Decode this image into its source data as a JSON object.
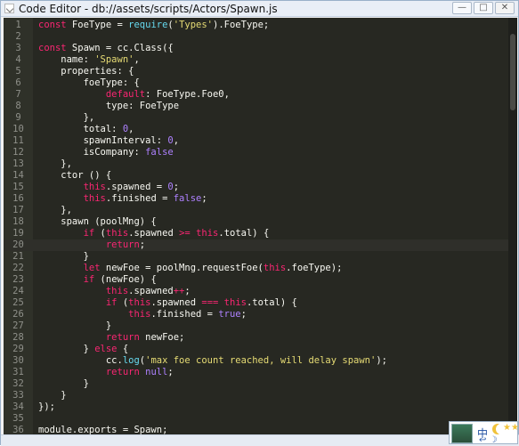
{
  "window": {
    "title": "Code Editor - db://assets/scripts/Actors/Spawn.js",
    "buttons": [
      "—",
      "□",
      "✕"
    ]
  },
  "editor": {
    "active_line": 20,
    "lines": [
      [
        [
          "k",
          "const"
        ],
        [
          "t",
          " FoeType = "
        ],
        [
          "f",
          "require"
        ],
        [
          "t",
          "("
        ],
        [
          "s",
          "'Types'"
        ],
        [
          "t",
          ").FoeType;"
        ]
      ],
      [],
      [
        [
          "k",
          "const"
        ],
        [
          "t",
          " Spawn = cc.Class({"
        ]
      ],
      [
        [
          "t",
          "    name: "
        ],
        [
          "s",
          "'Spawn'"
        ],
        [
          "t",
          ","
        ]
      ],
      [
        [
          "t",
          "    properties: {"
        ]
      ],
      [
        [
          "t",
          "        foeType: {"
        ]
      ],
      [
        [
          "t",
          "            "
        ],
        [
          "k",
          "default"
        ],
        [
          "t",
          ": FoeType.Foe0,"
        ]
      ],
      [
        [
          "t",
          "            type: FoeType"
        ]
      ],
      [
        [
          "t",
          "        },"
        ]
      ],
      [
        [
          "t",
          "        total: "
        ],
        [
          "n",
          "0"
        ],
        [
          "t",
          ","
        ]
      ],
      [
        [
          "t",
          "        spawnInterval: "
        ],
        [
          "n",
          "0"
        ],
        [
          "t",
          ","
        ]
      ],
      [
        [
          "t",
          "        isCompany: "
        ],
        [
          "n",
          "false"
        ]
      ],
      [
        [
          "t",
          "    },"
        ]
      ],
      [
        [
          "t",
          "    ctor () {"
        ]
      ],
      [
        [
          "t",
          "        "
        ],
        [
          "k",
          "this"
        ],
        [
          "t",
          ".spawned = "
        ],
        [
          "n",
          "0"
        ],
        [
          "t",
          ";"
        ]
      ],
      [
        [
          "t",
          "        "
        ],
        [
          "k",
          "this"
        ],
        [
          "t",
          ".finished = "
        ],
        [
          "n",
          "false"
        ],
        [
          "t",
          ";"
        ]
      ],
      [
        [
          "t",
          "    },"
        ]
      ],
      [
        [
          "t",
          "    spawn (poolMng) {"
        ]
      ],
      [
        [
          "t",
          "        "
        ],
        [
          "k",
          "if"
        ],
        [
          "t",
          " ("
        ],
        [
          "k",
          "this"
        ],
        [
          "t",
          ".spawned "
        ],
        [
          "k",
          ">="
        ],
        [
          "t",
          " "
        ],
        [
          "k",
          "this"
        ],
        [
          "t",
          ".total) {"
        ]
      ],
      [
        [
          "t",
          "            "
        ],
        [
          "k",
          "return"
        ],
        [
          "t",
          ";"
        ]
      ],
      [
        [
          "t",
          "        }"
        ]
      ],
      [
        [
          "t",
          "        "
        ],
        [
          "k",
          "let"
        ],
        [
          "t",
          " newFoe = poolMng.requestFoe("
        ],
        [
          "k",
          "this"
        ],
        [
          "t",
          ".foeType);"
        ]
      ],
      [
        [
          "t",
          "        "
        ],
        [
          "k",
          "if"
        ],
        [
          "t",
          " (newFoe) {"
        ]
      ],
      [
        [
          "t",
          "            "
        ],
        [
          "k",
          "this"
        ],
        [
          "t",
          ".spawned"
        ],
        [
          "k",
          "++"
        ],
        [
          "t",
          ";"
        ]
      ],
      [
        [
          "t",
          "            "
        ],
        [
          "k",
          "if"
        ],
        [
          "t",
          " ("
        ],
        [
          "k",
          "this"
        ],
        [
          "t",
          ".spawned "
        ],
        [
          "k",
          "==="
        ],
        [
          "t",
          " "
        ],
        [
          "k",
          "this"
        ],
        [
          "t",
          ".total) {"
        ]
      ],
      [
        [
          "t",
          "                "
        ],
        [
          "k",
          "this"
        ],
        [
          "t",
          ".finished = "
        ],
        [
          "n",
          "true"
        ],
        [
          "t",
          ";"
        ]
      ],
      [
        [
          "t",
          "            }"
        ]
      ],
      [
        [
          "t",
          "            "
        ],
        [
          "k",
          "return"
        ],
        [
          "t",
          " newFoe;"
        ]
      ],
      [
        [
          "t",
          "        } "
        ],
        [
          "k",
          "else"
        ],
        [
          "t",
          " {"
        ]
      ],
      [
        [
          "t",
          "            cc."
        ],
        [
          "f",
          "log"
        ],
        [
          "t",
          "("
        ],
        [
          "s",
          "'max foe count reached, will delay spawn'"
        ],
        [
          "t",
          ");"
        ]
      ],
      [
        [
          "t",
          "            "
        ],
        [
          "k",
          "return"
        ],
        [
          "t",
          " "
        ],
        [
          "n",
          "null"
        ],
        [
          "t",
          ";"
        ]
      ],
      [
        [
          "t",
          "        }"
        ]
      ],
      [
        [
          "t",
          "    }"
        ]
      ],
      [
        [
          "t",
          "});"
        ]
      ],
      [],
      [
        [
          "t",
          "module.exports = Spawn;"
        ]
      ]
    ]
  },
  "ime": {
    "lang": "中",
    "icons": "↩ ☽",
    "stars": "★★"
  },
  "colors": {
    "editor_bg": "#272822",
    "gutter_bg": "#2f3129",
    "keyword": "#f92672",
    "string": "#e6db74",
    "number": "#ae81ff",
    "function": "#66d9ef",
    "text": "#f8f8f2"
  }
}
